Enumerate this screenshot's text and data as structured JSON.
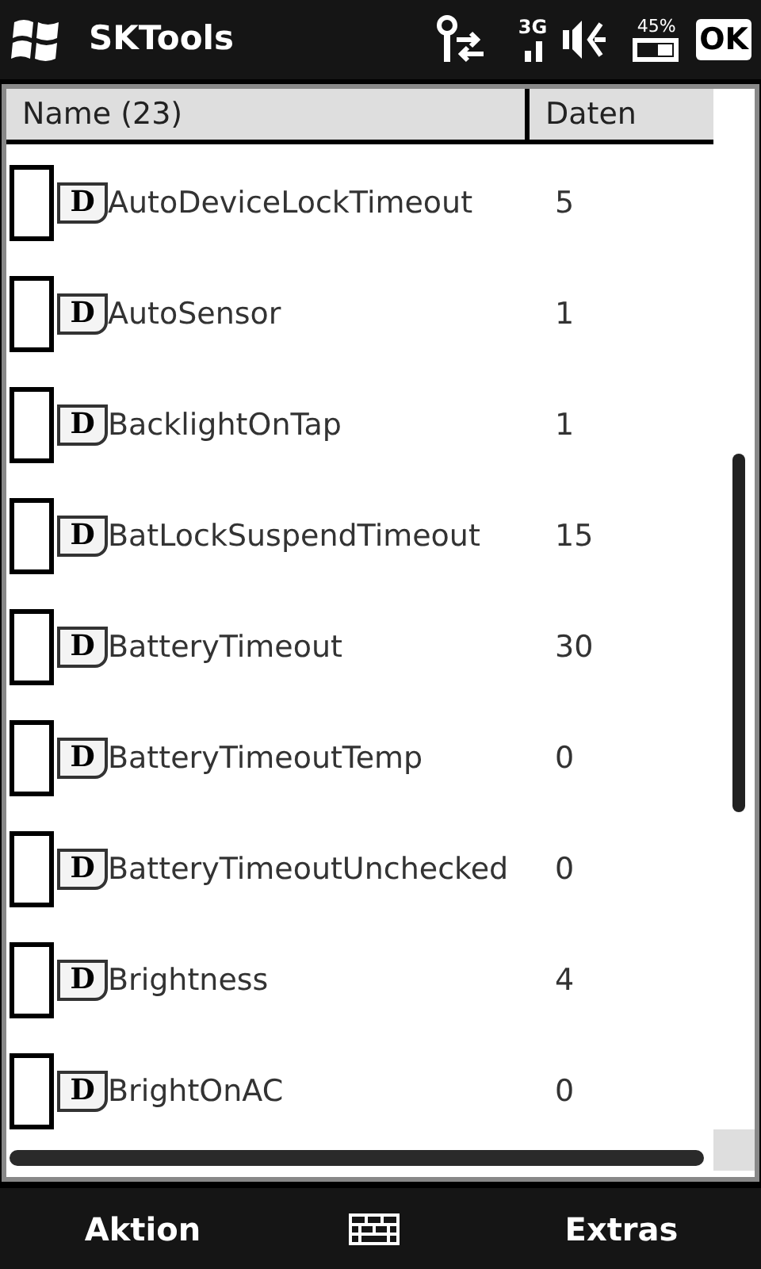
{
  "title_bar": {
    "title": "SKTools",
    "network_label": "3G",
    "battery_percent": "45%",
    "ok_button": "OK"
  },
  "table": {
    "columns": [
      "Name (23)",
      "Daten"
    ],
    "rows": [
      {
        "icon_letter": "D",
        "name": "AutoDeviceLockTimeout",
        "data": "5",
        "checked": false
      },
      {
        "icon_letter": "D",
        "name": "AutoSensor",
        "data": "1",
        "checked": false
      },
      {
        "icon_letter": "D",
        "name": "BacklightOnTap",
        "data": "1",
        "checked": false
      },
      {
        "icon_letter": "D",
        "name": "BatLockSuspendTimeout",
        "data": "15",
        "checked": false
      },
      {
        "icon_letter": "D",
        "name": "BatteryTimeout",
        "data": "30",
        "checked": false
      },
      {
        "icon_letter": "D",
        "name": "BatteryTimeoutTemp",
        "data": "0",
        "checked": false
      },
      {
        "icon_letter": "D",
        "name": "BatteryTimeoutUnchecked",
        "data": "0",
        "checked": false
      },
      {
        "icon_letter": "D",
        "name": "Brightness",
        "data": "4",
        "checked": false
      },
      {
        "icon_letter": "D",
        "name": "BrightOnAC",
        "data": "0",
        "checked": false
      }
    ]
  },
  "softkeys": {
    "left": "Aktion",
    "right": "Extras"
  }
}
